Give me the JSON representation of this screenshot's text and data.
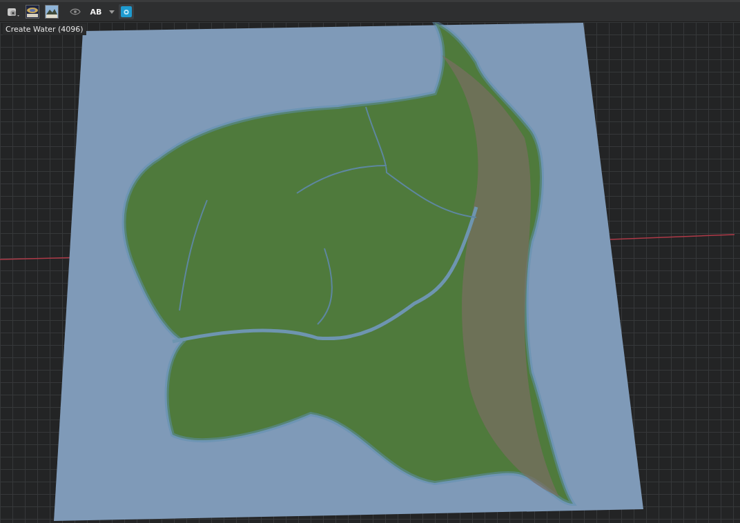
{
  "toolbar": {
    "text_tool_label": "AB"
  },
  "tooltip": {
    "text": "Create Water (4096)"
  }
}
